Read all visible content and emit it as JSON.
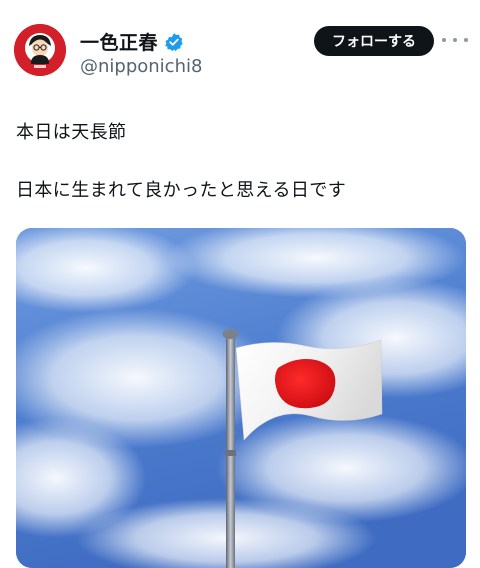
{
  "author": {
    "display_name": "一色正春",
    "handle": "@nipponichi8",
    "avatar_icon": "avatar-illustration-icon",
    "verified_icon": "verified-badge-icon",
    "accent_color": "#1d9bf0"
  },
  "actions": {
    "follow_label": "フォローする",
    "more_icon": "more-options-icon"
  },
  "tweet": {
    "lines": [
      "本日は天長節",
      "日本に生まれて良かったと思える日です"
    ]
  },
  "media": {
    "icon": "japan-flag-photo",
    "colors": {
      "sky": "#4f7fd0",
      "flag_red": "#e0121b",
      "flag_white": "#f4f4f4"
    }
  }
}
